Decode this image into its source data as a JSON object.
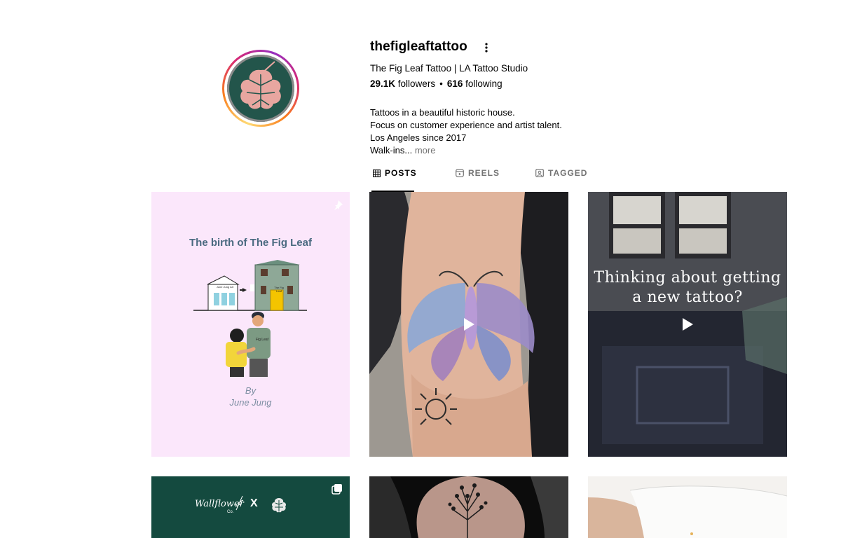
{
  "profile": {
    "username": "thefigleaftattoo",
    "display_name": "The Fig Leaf Tattoo | LA Tattoo Studio",
    "followers_count": "29.1K",
    "followers_label": "followers",
    "separator": "•",
    "following_count": "616",
    "following_label": "following",
    "bio_lines": [
      "Tattoos in a beautiful historic house.",
      "Focus on customer experience and artist talent.",
      "Los Angeles since 2017",
      "Walk-ins..."
    ],
    "bio_more": "more",
    "avatar_icon": "fig-leaf-logo",
    "avatar_bg": "#23554b",
    "leaf_color": "#e8a6a0"
  },
  "tabs": [
    {
      "label": "POSTS",
      "icon": "grid-icon",
      "active": true
    },
    {
      "label": "REELS",
      "icon": "reels-icon",
      "active": false
    },
    {
      "label": "TAGGED",
      "icon": "tagged-icon",
      "active": false
    }
  ],
  "posts": [
    {
      "kind": "pinned-illustration",
      "pinned": true,
      "title": "The birth of The Fig Leaf",
      "shop_sign_left": "June Jung Art",
      "shop_sign_right": "The Fig Leaf",
      "shirt_text": "Fig Leaf",
      "byline_1": "By",
      "byline_2": "June Jung",
      "bg": "#fbe7fb"
    },
    {
      "kind": "reel",
      "icon": "play-icon",
      "subject": "moth tattoo on arm"
    },
    {
      "kind": "reel",
      "icon": "play-icon",
      "caption_1": "Thinking about getting",
      "caption_2": "a new tattoo?"
    },
    {
      "kind": "carousel",
      "icon": "carousel-icon",
      "brand": "Wallflower",
      "brand_sub": "Co.",
      "times": "X",
      "bg": "#144a3f"
    },
    {
      "kind": "photo",
      "subject": "fine line botanical tattoo"
    },
    {
      "kind": "photo",
      "subject": "paper with hand"
    }
  ],
  "more_icon": "more-options-icon"
}
